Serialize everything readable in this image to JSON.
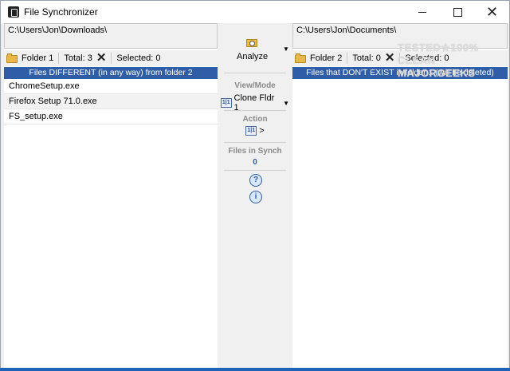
{
  "window": {
    "title": "File Synchronizer"
  },
  "left_pane": {
    "path": "C:\\Users\\Jon\\Downloads\\",
    "folder_label": "Folder 1",
    "total_label": "Total: 3",
    "selected_label": "Selected: 0",
    "status_band": "Files DIFFERENT (in any way) from folder 2",
    "files": [
      "ChromeSetup.exe",
      "Firefox Setup 71.0.exe",
      "FS_setup.exe"
    ]
  },
  "right_pane": {
    "path": "C:\\Users\\Jon\\Documents\\",
    "folder_label": "Folder 2",
    "total_label": "Total: 0",
    "selected_label": "Selected: 0",
    "status_band": "Files that DON'T EXIST in folder 1 (will be deleted)",
    "files": []
  },
  "middle": {
    "analyze_label": "Analyze",
    "view_mode_title": "View/Mode",
    "view_mode_icon_text": "1|1",
    "view_mode_value": "Clone Fldr 1",
    "action_title": "Action",
    "action_icon_text": "1|1",
    "action_value": ">",
    "files_in_synch_title": "Files in Synch",
    "files_in_synch_count": "0",
    "help_icon_text": "?",
    "info_icon_text": "i"
  },
  "watermark": {
    "line1": "TESTED★100% CLEAN",
    "line2": "MAJORGEEKS"
  },
  "colors": {
    "status_band": "#2f5da8",
    "accent_blue": "#2f5da8",
    "taskbar": "#1f63b8"
  }
}
